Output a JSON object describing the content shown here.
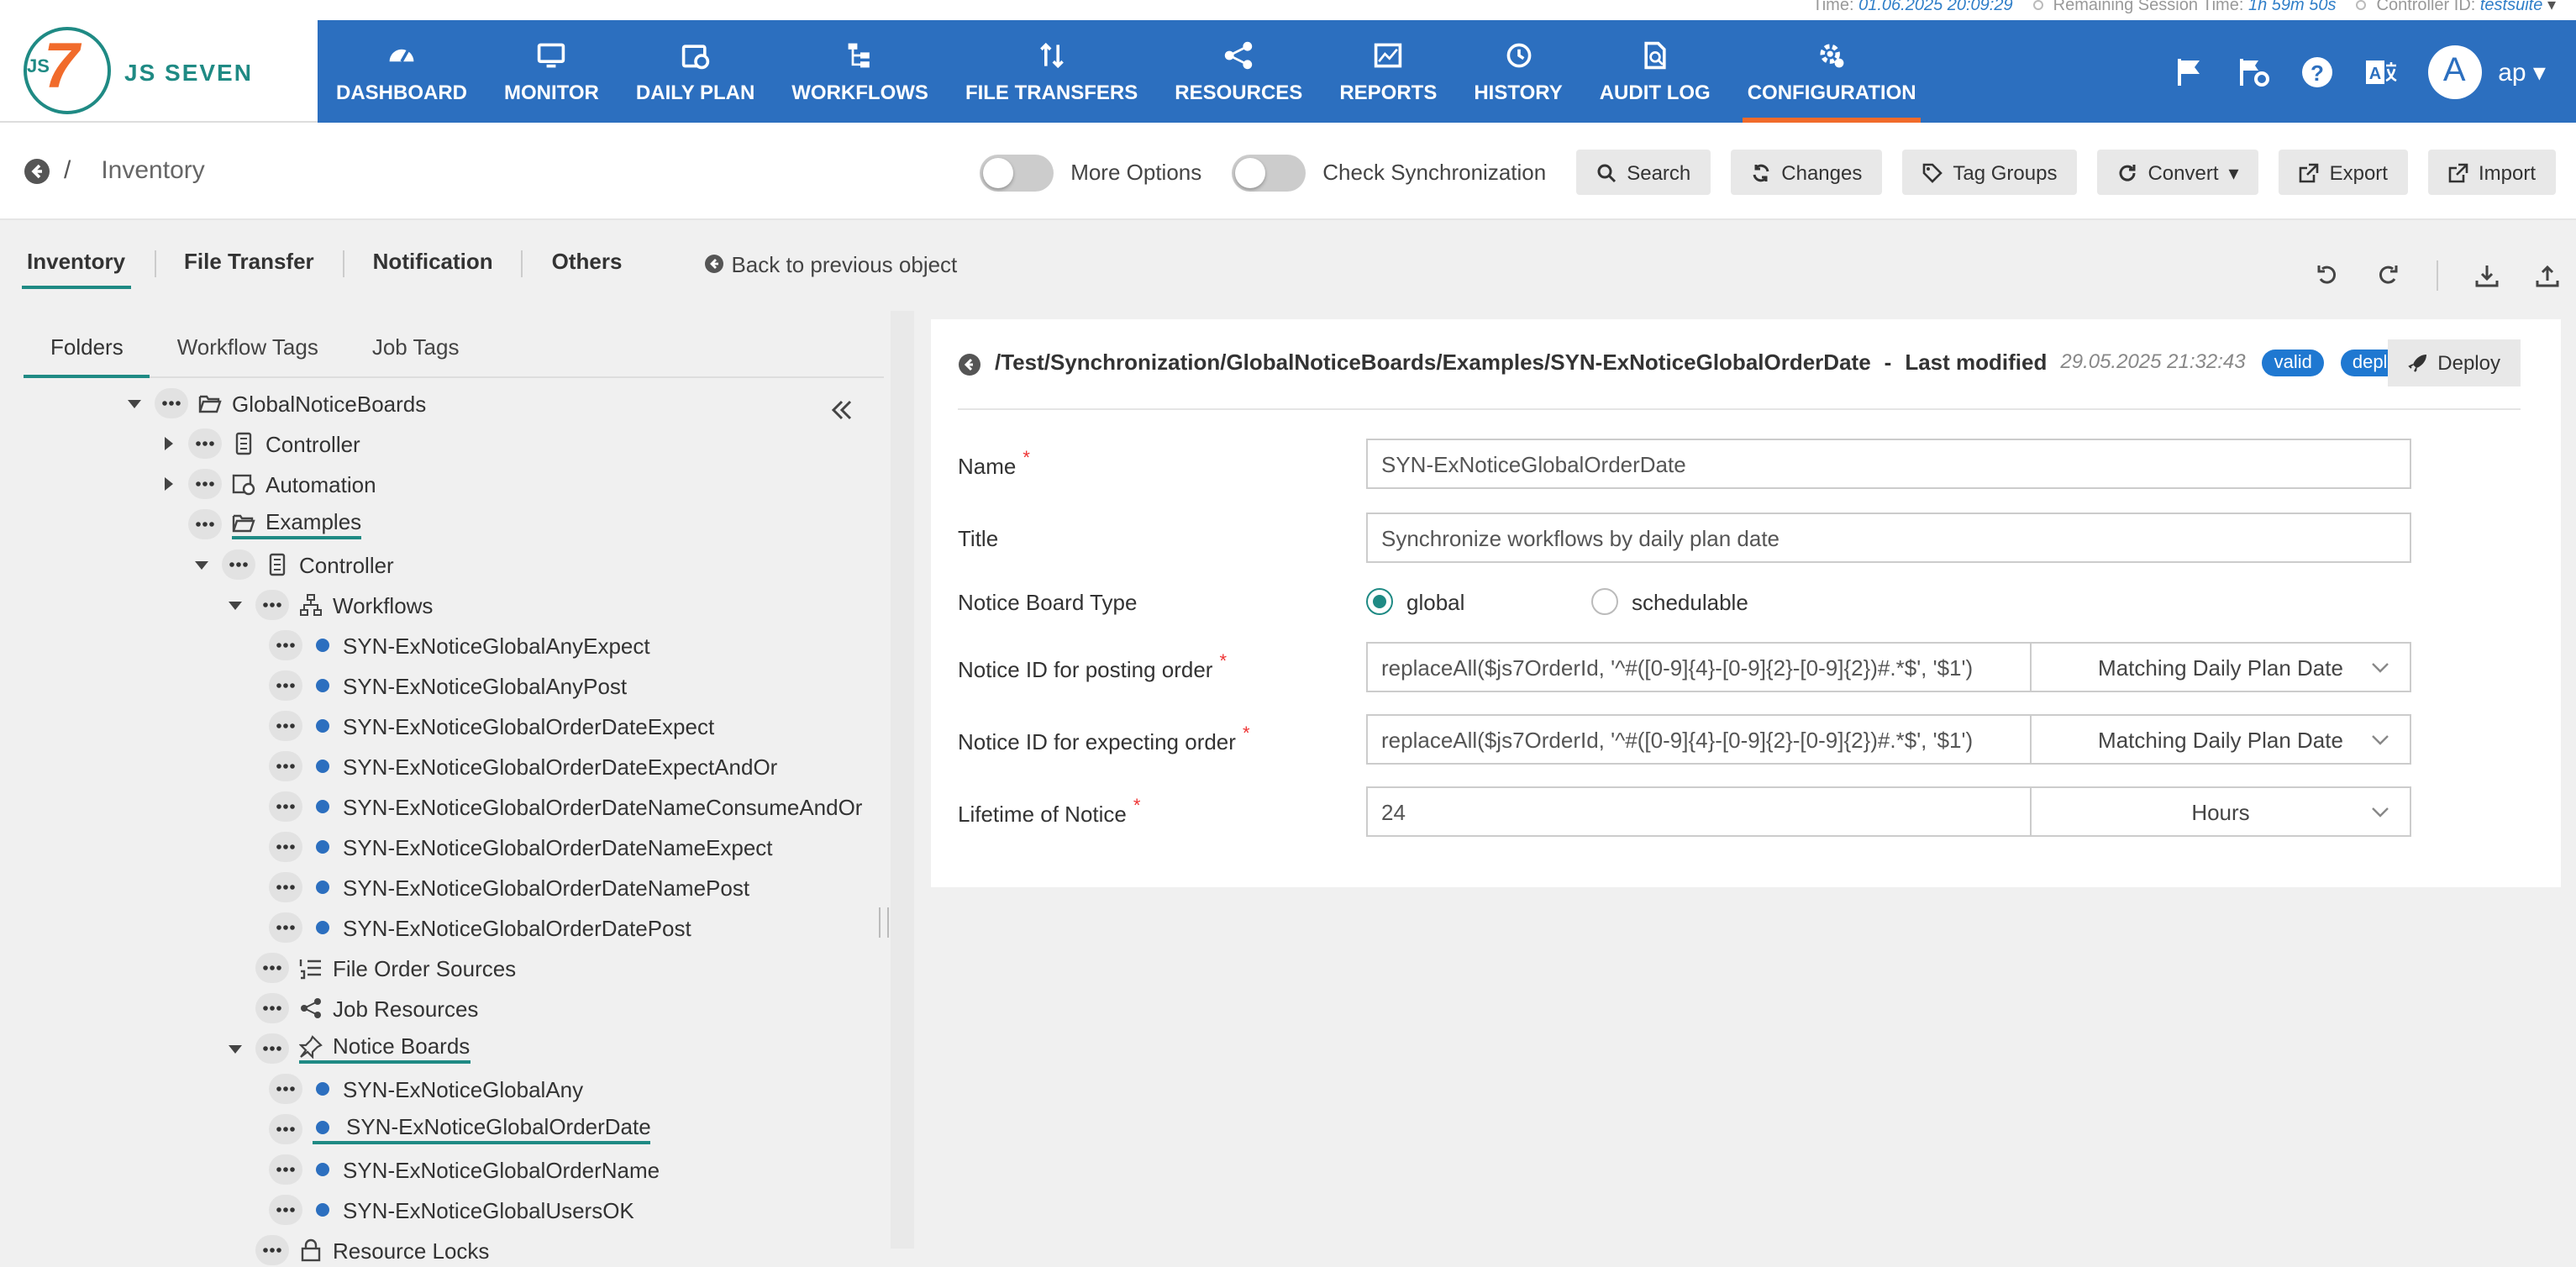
{
  "status": {
    "time_label": "Time:",
    "time": "01.06.2025 20:09:29",
    "session_label": "Remaining Session Time:",
    "session": "1h 59m 50s",
    "controller_label": "Controller ID:",
    "controller": "testsuite"
  },
  "brand": {
    "name": "JS SEVEN",
    "mark_js": "JS",
    "mark_7": "7"
  },
  "nav": {
    "items": [
      "DASHBOARD",
      "MONITOR",
      "DAILY PLAN",
      "WORKFLOWS",
      "FILE TRANSFERS",
      "RESOURCES",
      "REPORTS",
      "HISTORY",
      "AUDIT LOG",
      "CONFIGURATION"
    ],
    "active": "CONFIGURATION",
    "avatar_letter": "A",
    "user": "ap"
  },
  "toolbar": {
    "separator": "/",
    "title": "Inventory",
    "more_options": "More Options",
    "check_sync": "Check Synchronization",
    "search": "Search",
    "changes": "Changes",
    "tag_groups": "Tag Groups",
    "convert": "Convert",
    "export": "Export",
    "import": "Import"
  },
  "tabs": {
    "items": [
      "Inventory",
      "File Transfer",
      "Notification",
      "Others"
    ],
    "back": "Back to previous object"
  },
  "subtabs": [
    "Folders",
    "Workflow Tags",
    "Job Tags"
  ],
  "tree": [
    "GlobalNoticeBoards",
    "Controller",
    "Automation",
    "Examples",
    "Controller",
    "Workflows",
    "SYN-ExNoticeGlobalAnyExpect",
    "SYN-ExNoticeGlobalAnyPost",
    "SYN-ExNoticeGlobalOrderDateExpect",
    "SYN-ExNoticeGlobalOrderDateExpectAndOr",
    "SYN-ExNoticeGlobalOrderDateNameConsumeAndOr",
    "SYN-ExNoticeGlobalOrderDateNameExpect",
    "SYN-ExNoticeGlobalOrderDateNamePost",
    "SYN-ExNoticeGlobalOrderDatePost",
    "File Order Sources",
    "Job Resources",
    "Notice Boards",
    "SYN-ExNoticeGlobalAny",
    "SYN-ExNoticeGlobalOrderDate",
    "SYN-ExNoticeGlobalOrderName",
    "SYN-ExNoticeGlobalUsersOK",
    "Resource Locks"
  ],
  "detail": {
    "path": "/Test/Synchronization/GlobalNoticeBoards/Examples/SYN-ExNoticeGlobalOrderDate",
    "dash": "-",
    "last_modified_label": "Last modified",
    "last_modified": "29.05.2025 21:32:43",
    "badge_valid": "valid",
    "badge_deployed": "deployed",
    "deploy": "Deploy",
    "name_label": "Name",
    "name_value": "SYN-ExNoticeGlobalOrderDate",
    "title_label": "Title",
    "title_value": "Synchronize workflows by daily plan date",
    "type_label": "Notice Board Type",
    "type_global": "global",
    "type_schedulable": "schedulable",
    "type_selected": "global",
    "posting_label": "Notice ID for posting order",
    "posting_value": "replaceAll($js7OrderId, '^#([0-9]{4}-[0-9]{2}-[0-9]{2})#.*$', '$1')",
    "posting_select": "Matching Daily Plan Date",
    "expecting_label": "Notice ID for expecting order",
    "expecting_value": "replaceAll($js7OrderId, '^#([0-9]{4}-[0-9]{2}-[0-9]{2})#.*$', '$1')",
    "expecting_select": "Matching Daily Plan Date",
    "lifetime_label": "Lifetime of Notice",
    "lifetime_value": "24",
    "lifetime_unit": "Hours",
    "required_mark": "*"
  },
  "colors": {
    "nav": "#2c6fbf",
    "accent": "#1f8a84",
    "orange": "#f16b2b",
    "badge": "#1f78d1"
  }
}
